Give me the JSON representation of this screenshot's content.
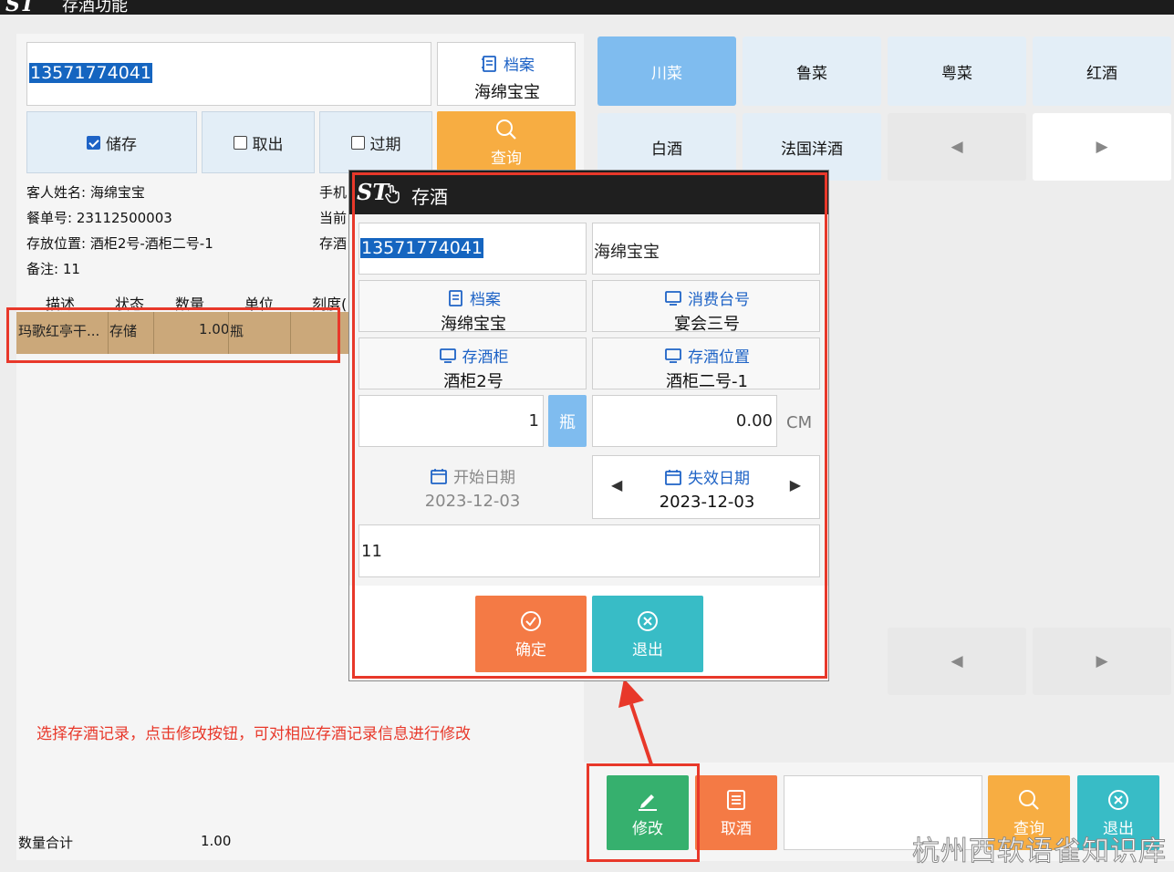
{
  "title_bar": {
    "logo": "ST",
    "title": "存酒功能"
  },
  "left": {
    "phone": "13571774041",
    "archive_label": "档案",
    "archive_value": "海绵宝宝",
    "checkboxes": [
      {
        "label": "储存",
        "checked": true
      },
      {
        "label": "取出",
        "checked": false
      },
      {
        "label": "过期",
        "checked": false
      }
    ],
    "query_label": "查询",
    "info_lines": [
      "客人姓名: 海绵宝宝",
      "餐单号: 23112500003",
      "存放位置: 酒柜2号-酒柜二号-1",
      "备注: 11"
    ],
    "info_right": [
      "手机",
      "当前",
      "存酒"
    ],
    "table_headers": [
      "描述",
      "状态",
      "数量",
      "单位",
      "刻度("
    ],
    "table_row": {
      "desc": "玛歌红亭干...",
      "status": "存储",
      "qty": "1.00",
      "unit": "瓶"
    },
    "annotation": "选择存酒记录，点击修改按钮，可对相应存酒记录信息进行修改",
    "total_label": "数量合计",
    "total_value": "1.00"
  },
  "categories": {
    "row1": [
      "川菜",
      "鲁菜",
      "粤菜",
      "红酒"
    ],
    "row2": [
      "白酒",
      "法国洋酒"
    ],
    "prev": "◀",
    "next": "▶"
  },
  "dialog": {
    "title": "存酒",
    "phone": "13571774041",
    "name": "海绵宝宝",
    "archive_label": "档案",
    "archive_value": "海绵宝宝",
    "table_label": "消费台号",
    "table_value": "宴会三号",
    "cabinet_label": "存酒柜",
    "cabinet_value": "酒柜2号",
    "position_label": "存酒位置",
    "position_value": "酒柜二号-1",
    "quantity": "1",
    "unit": "瓶",
    "scale": "0.00",
    "scale_unit": "CM",
    "start_label": "开始日期",
    "start_value": "2023-12-03",
    "expire_label": "失效日期",
    "expire_value": "2023-12-03",
    "remark": "11",
    "confirm": "确定",
    "exit": "退出"
  },
  "bottom": {
    "edit": "修改",
    "take": "取酒",
    "query": "查询",
    "exit": "退出"
  },
  "watermark": "杭州西软语雀知识库",
  "colors": {
    "accent_red": "#e8382a",
    "orange": "#f47a45",
    "teal": "#38bcc6",
    "green": "#36b06e",
    "amber": "#f7ad42",
    "blue": "#1e63c6"
  }
}
